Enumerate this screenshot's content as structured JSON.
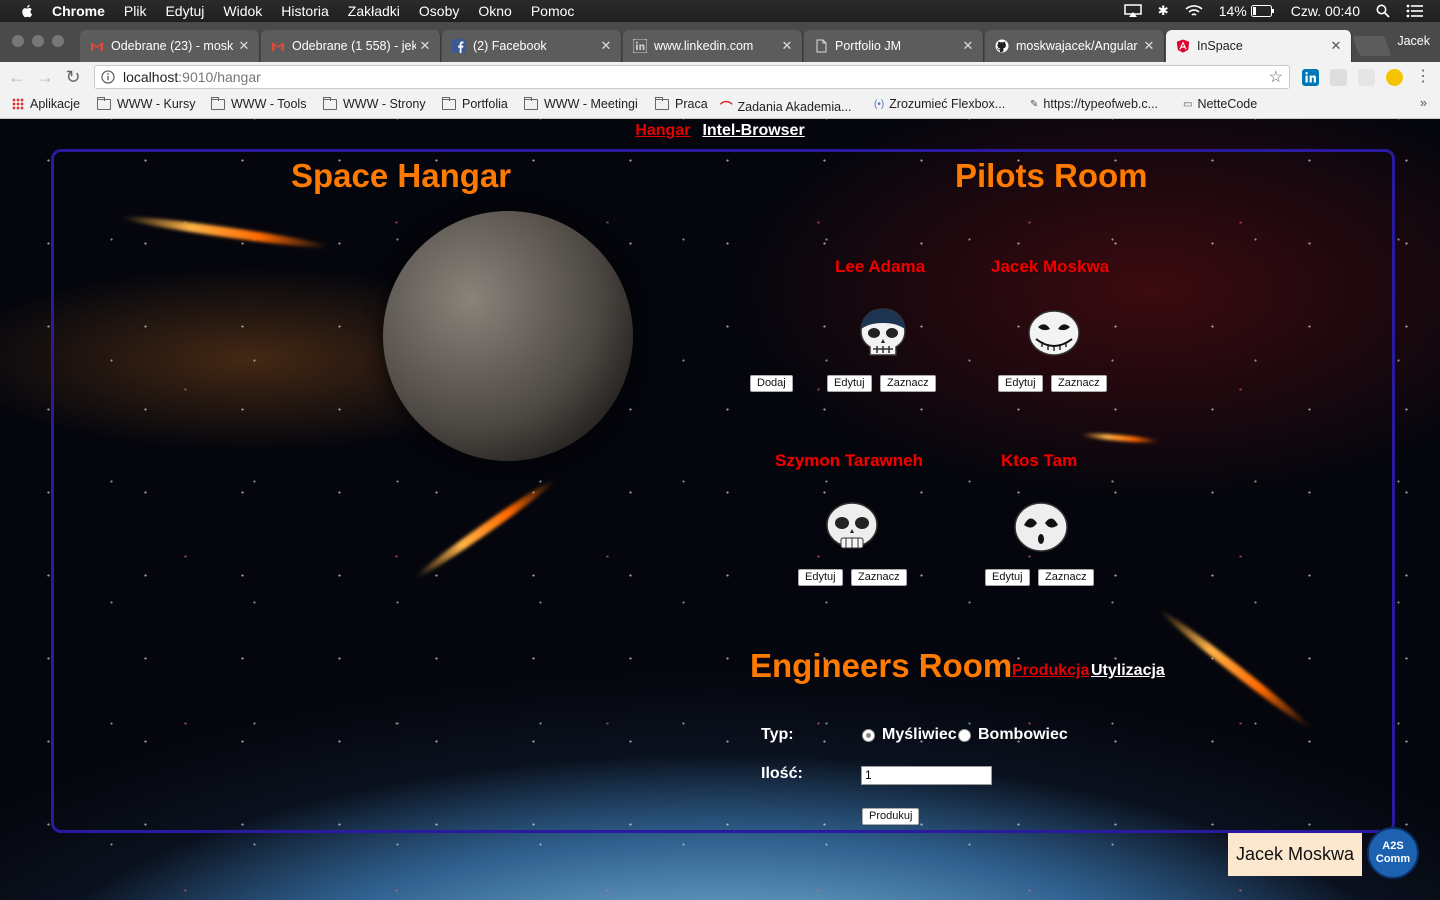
{
  "menubar": {
    "items": [
      "Chrome",
      "Plik",
      "Edytuj",
      "Widok",
      "Historia",
      "Zakładki",
      "Osoby",
      "Okno",
      "Pomoc"
    ],
    "battery": "14%",
    "clock": "Czw. 00:40"
  },
  "tabs": [
    {
      "title": "Odebrane (23) - mosk",
      "icon": "gmail-icon"
    },
    {
      "title": "Odebrane (1 558) - jek",
      "icon": "gmail-icon"
    },
    {
      "title": "(2) Facebook",
      "icon": "facebook-icon"
    },
    {
      "title": "www.linkedin.com",
      "icon": "linkedin-icon"
    },
    {
      "title": "Portfolio JM",
      "icon": "page-icon"
    },
    {
      "title": "moskwajacek/Angular",
      "icon": "github-icon"
    },
    {
      "title": "InSpace",
      "icon": "angular-icon",
      "active": true
    }
  ],
  "profile_name": "Jacek",
  "address": {
    "host": "localhost",
    "path": ":9010/hangar"
  },
  "bookmarks": [
    {
      "label": "Aplikacje",
      "icon": "apps-grid-icon"
    },
    {
      "label": "WWW - Kursy",
      "icon": "folder-icon"
    },
    {
      "label": "WWW - Tools",
      "icon": "folder-icon"
    },
    {
      "label": "WWW - Strony",
      "icon": "folder-icon"
    },
    {
      "label": "Portfolia",
      "icon": "folder-icon"
    },
    {
      "label": "WWW - Meetingi",
      "icon": "folder-icon"
    },
    {
      "label": "Praca",
      "icon": "folder-icon"
    },
    {
      "label": "Zadania Akademia...",
      "icon": "arc-icon"
    },
    {
      "label": "Zrozumieć Flexbox...",
      "icon": "flexbox-icon"
    },
    {
      "label": "https://typeofweb.c...",
      "icon": "typeofweb-icon"
    },
    {
      "label": "NetteCode",
      "icon": "nette-icon"
    }
  ],
  "nav": {
    "hangar": "Hangar",
    "intel": "Intel-Browser"
  },
  "hangar_title": "Space Hangar",
  "pilots_title": "Pilots Room",
  "pilots": [
    {
      "name": "Lee Adama",
      "edit": "Edytuj",
      "select": "Zaznacz"
    },
    {
      "name": "Jacek Moskwa",
      "edit": "Edytuj",
      "select": "Zaznacz"
    },
    {
      "name": "Szymon Tarawneh",
      "edit": "Edytuj",
      "select": "Zaznacz"
    },
    {
      "name": "Ktos Tam",
      "edit": "Edytuj",
      "select": "Zaznacz"
    }
  ],
  "add_button": "Dodaj",
  "engineers": {
    "title": "Engineers Room",
    "tab_production": "Produkcja",
    "tab_recycling": "Utylizacja",
    "type_label": "Typ:",
    "type_options": [
      "Myśliwiec",
      "Bombowiec"
    ],
    "type_selected": "Myśliwiec",
    "qty_label": "Ilość:",
    "qty_value": "1",
    "produce_button": "Produkuj"
  },
  "user_name": "Jacek Moskwa",
  "badge": {
    "line1": "A2S",
    "line2": "Comm"
  }
}
